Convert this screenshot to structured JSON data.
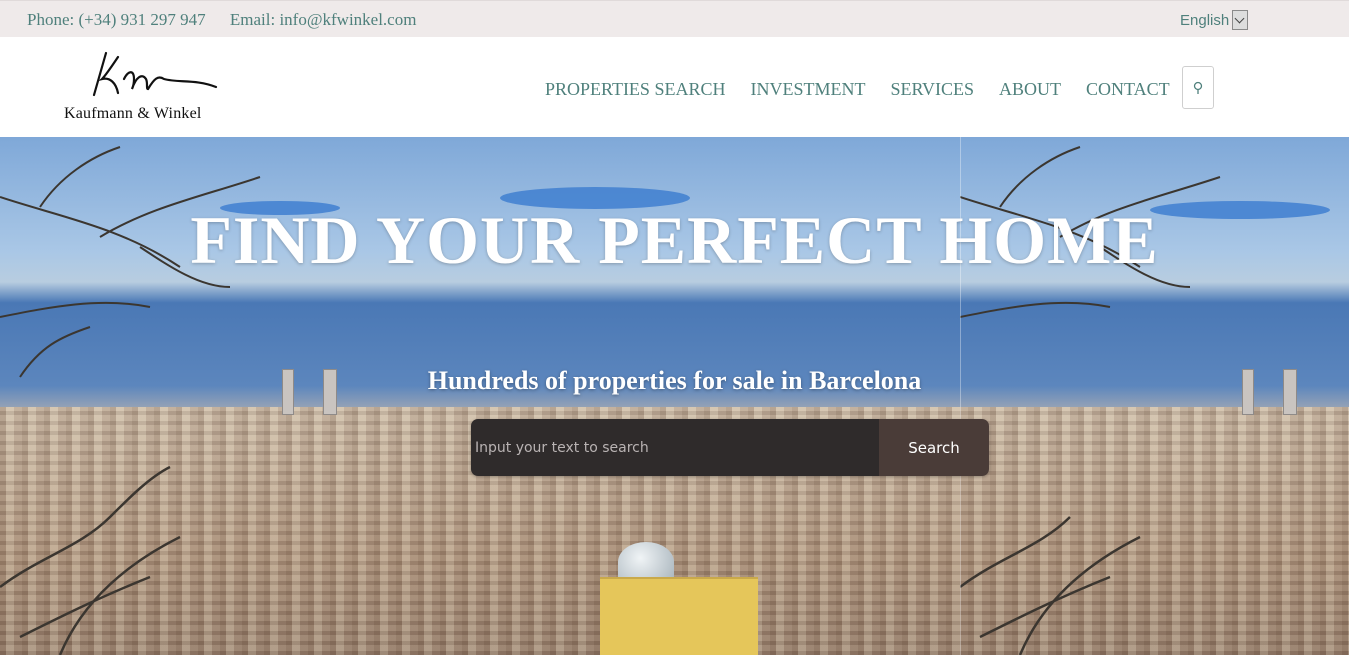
{
  "topbar": {
    "phone": "Phone: (+34) 931 297 947",
    "email": "Email: info@kfwinkel.com",
    "language": "English"
  },
  "header": {
    "logo_text": "Kaufmann & Winkel",
    "nav": [
      {
        "label": "PROPERTIES SEARCH"
      },
      {
        "label": "INVESTMENT"
      },
      {
        "label": "SERVICES"
      },
      {
        "label": "ABOUT"
      },
      {
        "label": "CONTACT"
      }
    ],
    "search_icon": "search-icon"
  },
  "hero": {
    "title": "FIND YOUR PERFECT HOME",
    "subtitle": "Hundreds of properties for sale in Barcelona",
    "search_placeholder": "Input your text to search",
    "search_button": "Search"
  },
  "colors": {
    "accent": "#4f807c",
    "topbar_bg": "#efeaea",
    "search_input_bg": "#2f2b2b",
    "search_button_bg": "#4a3c38"
  }
}
